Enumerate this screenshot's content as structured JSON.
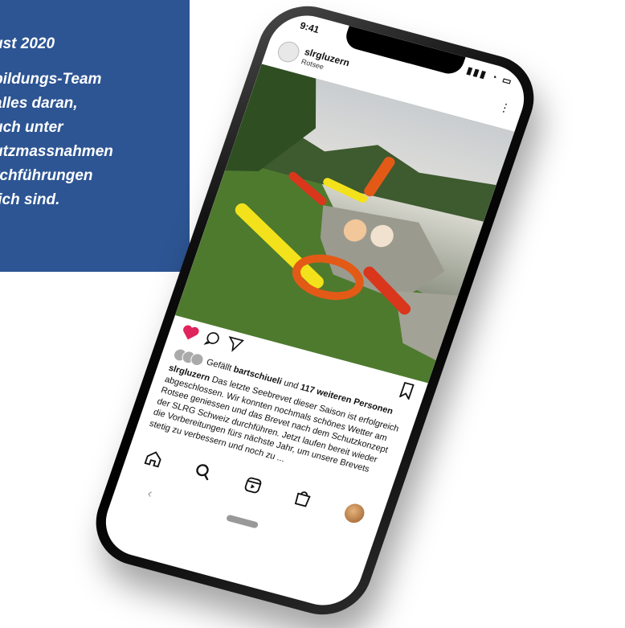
{
  "quote": {
    "date": "ust 2020",
    "lines": [
      "bildungs-Team",
      "alles daran,",
      "uch unter",
      "utzmassnahmen",
      "rchführungen",
      "lich sind."
    ]
  },
  "status_bar": {
    "time": "9:41",
    "icons": "signal wifi battery"
  },
  "post": {
    "username": "slrgluzern",
    "location": "Rotsee",
    "more_icon": "more-dots-icon",
    "like_prefix": "Gefällt",
    "like_user": "bartschiueli",
    "like_middle": "und",
    "like_count": "117 weiteren Personen",
    "caption_user": "slrgluzern",
    "caption_text": "Das letzte Seebrevet dieser Saison ist erfolgreich abgeschlossen. Wir konnten nochmals schönes Wetter am Rotsee geniessen und das Brevet nach dem Schutzkonzept der SLRG Schweiz durchführen. Jetzt laufen bereit wieder die Vorbereitungen fürs nächste Jahr, um unsere Brevets stetig zu verbessern und noch zu ...",
    "heart_color": "#e0245e"
  },
  "bottom_nav": {
    "items": [
      "home-icon",
      "search-icon",
      "reels-icon",
      "shop-icon",
      "profile-avatar"
    ]
  }
}
